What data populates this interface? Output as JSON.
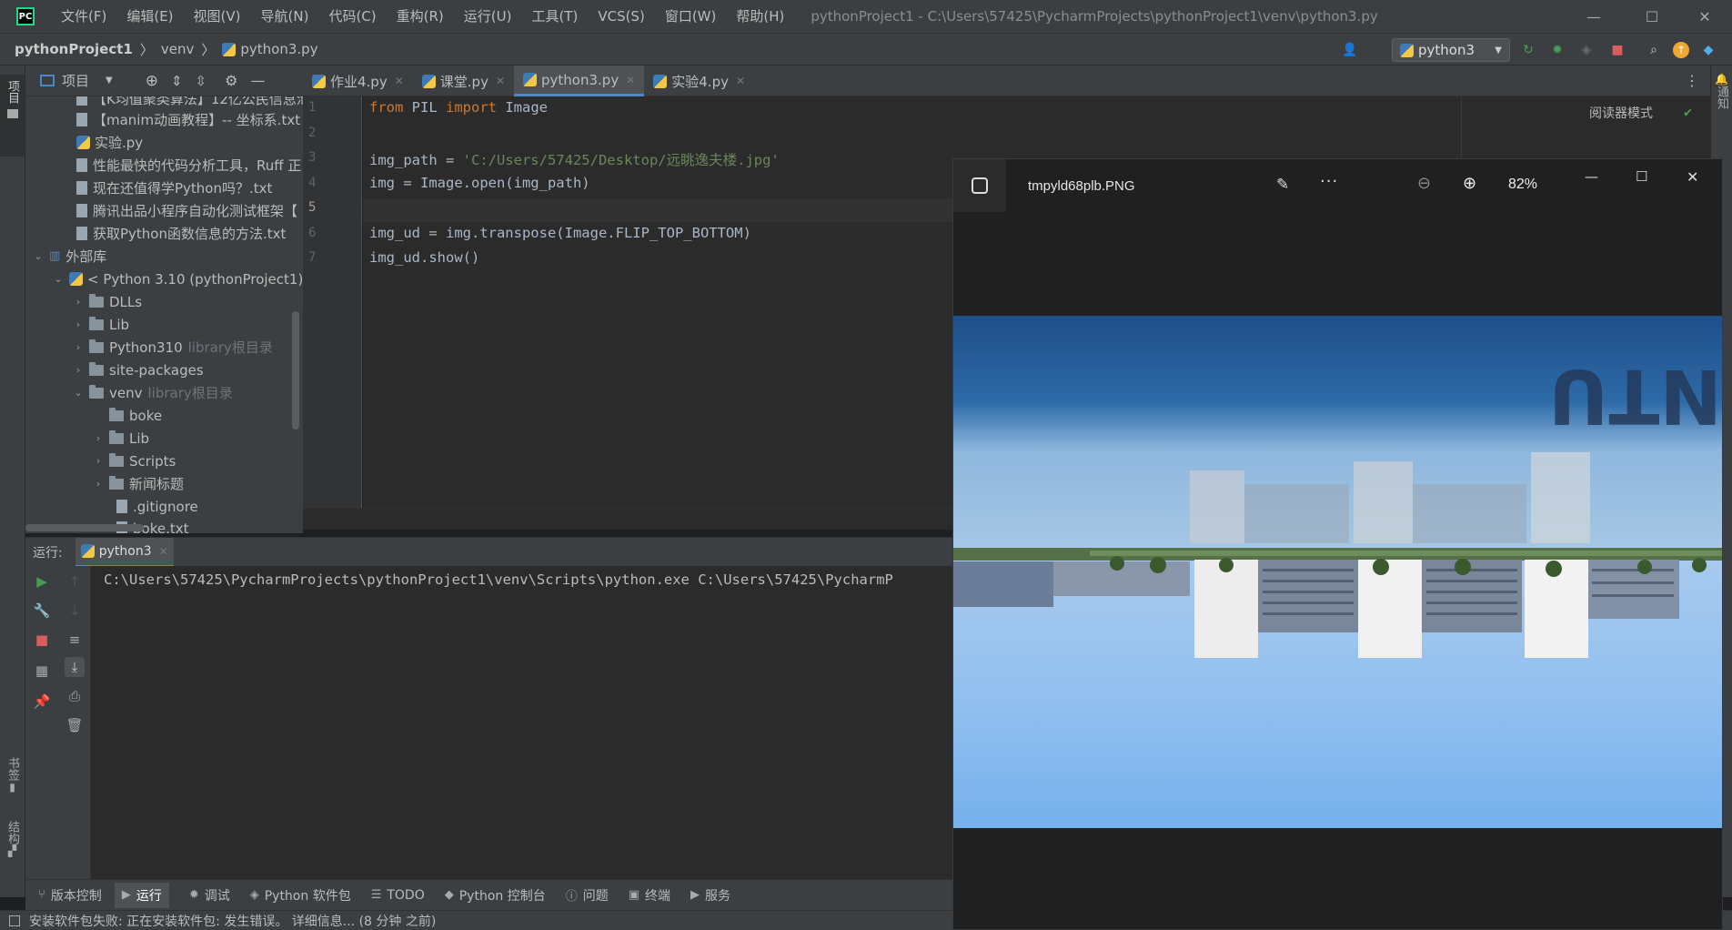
{
  "titlebar": {
    "menu": [
      "文件(F)",
      "编辑(E)",
      "视图(V)",
      "导航(N)",
      "代码(C)",
      "重构(R)",
      "运行(U)",
      "工具(T)",
      "VCS(S)",
      "窗口(W)",
      "帮助(H)"
    ],
    "window_title": "pythonProject1 - C:\\Users\\57425\\PycharmProjects\\pythonProject1\\venv\\python3.py"
  },
  "navbar": {
    "crumbs": [
      "pythonProject1",
      "venv",
      "python3.py"
    ],
    "run_config": "python3"
  },
  "left_strip": {
    "project": "项目",
    "bookmarks": "书签",
    "structure": "结构"
  },
  "right_strip": {
    "notifications": "通知"
  },
  "project_panel": {
    "title": "项目",
    "items": [
      "【K均值聚类算法】12亿公民信息泄",
      "【manim动画教程】-- 坐标系.txt",
      "实验.py",
      "性能最快的代码分析工具，Ruff 正",
      "现在还值得学Python吗？.txt",
      "腾讯出品小程序自动化测试框架【",
      "获取Python函数信息的方法.txt",
      "外部库",
      "< Python 3.10 (pythonProject1)",
      "DLLs",
      "Lib",
      "Python310",
      "site-packages",
      "venv",
      "boke",
      "Lib",
      "Scripts",
      "新闻标题",
      ".gitignore",
      "boke.txt"
    ],
    "library_root_label": "library根目录"
  },
  "tabs": [
    {
      "label": "作业4.py",
      "active": false
    },
    {
      "label": "课堂.py",
      "active": false
    },
    {
      "label": "python3.py",
      "active": true
    },
    {
      "label": "实验4.py",
      "active": false
    }
  ],
  "editor": {
    "reader_mode": "阅读器模式",
    "line_numbers": [
      "1",
      "2",
      "3",
      "4",
      "5",
      "6",
      "7"
    ],
    "lines": {
      "l1_kw1": "from",
      "l1_mod": " PIL ",
      "l1_kw2": "import",
      "l1_name": " Image",
      "l3_var": "img_path = ",
      "l3_str": "'C:/Users/57425/Desktop/远眺逸夫楼.jpg'",
      "l4": "img = Image.open(img_path)",
      "l6": "img_ud = img.transpose(Image.FLIP_TOP_BOTTOM)",
      "l7": "img_ud.show()"
    }
  },
  "run_panel": {
    "label": "运行:",
    "tab": "python3",
    "console_line": "C:\\Users\\57425\\PycharmProjects\\pythonProject1\\venv\\Scripts\\python.exe C:\\Users\\57425\\PycharmP"
  },
  "tool_windows": [
    "版本控制",
    "运行",
    "调试",
    "Python 软件包",
    "TODO",
    "Python 控制台",
    "问题",
    "终端",
    "服务"
  ],
  "status": "安装软件包失败: 正在安装软件包: 发生错误。 详细信息... (8 分钟 之前)",
  "viewer": {
    "filename": "tmpyld68plb.PNG",
    "zoom": "82%",
    "sign_text": "NTU"
  },
  "colors": {
    "accent": "#4a88c7",
    "keyword": "#cc7832",
    "string": "#6a8759",
    "run_green": "#499c54",
    "stop_red": "#db5c5c"
  }
}
